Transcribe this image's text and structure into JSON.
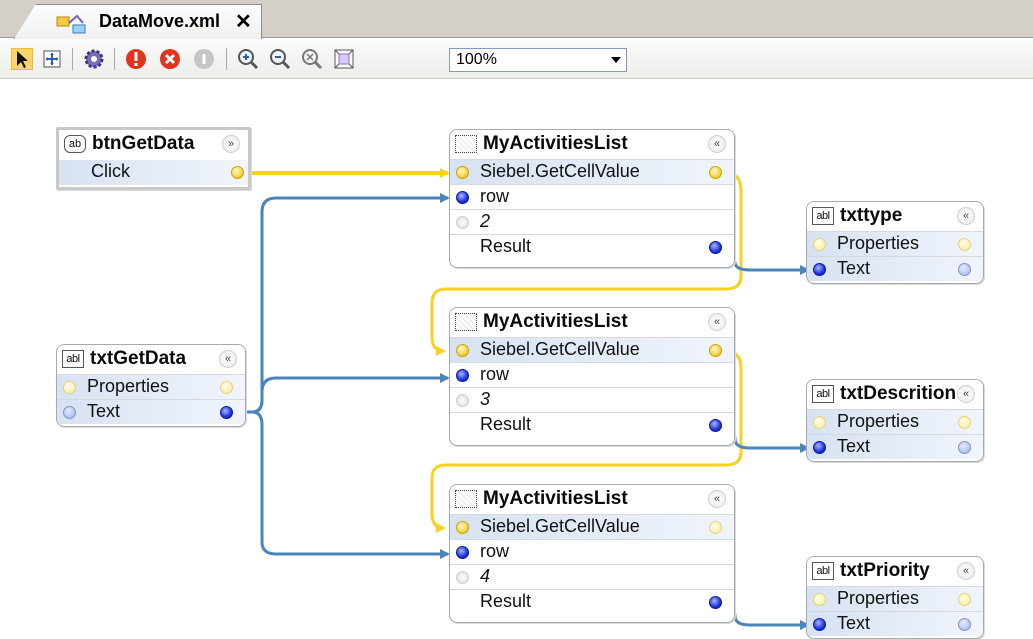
{
  "tab": {
    "title": "DataMove.xml",
    "close_symbol": "✕"
  },
  "toolbar": {
    "zoom_value": "100%"
  },
  "nodes": {
    "btnGetData": {
      "title": "btnGetData",
      "icon_text": "ab",
      "rows": [
        "Click"
      ]
    },
    "txtGetData": {
      "title": "txtGetData",
      "icon_text": "abl",
      "rows": [
        "Properties",
        "Text"
      ]
    },
    "list1": {
      "title": "MyActivitiesList",
      "rows": [
        "Siebel.GetCellValue",
        "row",
        "2",
        "Result"
      ]
    },
    "list2": {
      "title": "MyActivitiesList",
      "rows": [
        "Siebel.GetCellValue",
        "row",
        "3",
        "Result"
      ]
    },
    "list3": {
      "title": "MyActivitiesList",
      "rows": [
        "Siebel.GetCellValue",
        "row",
        "4",
        "Result"
      ]
    },
    "txttype": {
      "title": "txttype",
      "icon_text": "abl",
      "rows": [
        "Properties",
        "Text"
      ]
    },
    "txtDescrition": {
      "title": "txtDescrition",
      "icon_text": "abl",
      "rows": [
        "Properties",
        "Text"
      ]
    },
    "txtPriority": {
      "title": "txtPriority",
      "icon_text": "abl",
      "rows": [
        "Properties",
        "Text"
      ]
    }
  },
  "colors": {
    "event_wire": "#f7d21f",
    "data_wire": "#4a84b8",
    "toolbar_bg": "#f1f1ee"
  },
  "icons": [
    "pointer-icon",
    "fit-to-window-icon",
    "settings-gear-icon",
    "stop-red-icon",
    "cancel-red-icon",
    "disabled-gray-icon",
    "zoom-in-icon",
    "zoom-out-icon",
    "zoom-reset-icon",
    "zoom-fit-icon",
    "dropdown-arrow-icon"
  ]
}
